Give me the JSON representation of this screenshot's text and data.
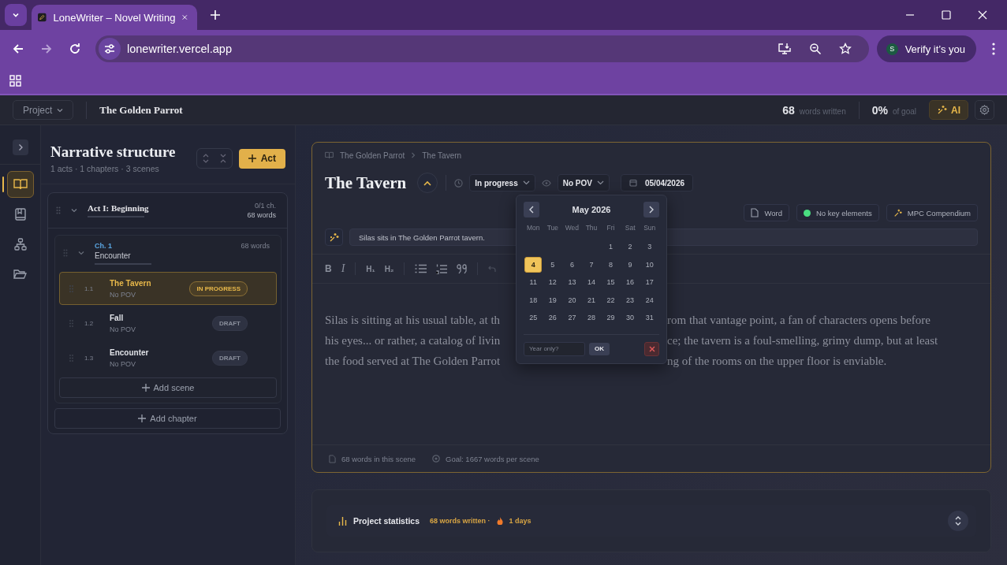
{
  "browser": {
    "tab_title": "LoneWriter – Novel Writing",
    "url": "lonewriter.vercel.app",
    "profile_initial": "S",
    "profile_label": "Verify it’s you"
  },
  "header": {
    "project_menu": "Project",
    "project_title": "The Golden Parrot",
    "words_count": "68",
    "words_label": "words written",
    "goal_percent": "0%",
    "goal_label": "of goal",
    "ai_button": "AI"
  },
  "rail": {
    "items": [
      {
        "kind": "book",
        "selected": true
      },
      {
        "kind": "bookmark",
        "selected": false
      },
      {
        "kind": "hierarchy",
        "selected": false
      },
      {
        "kind": "folder",
        "selected": false
      }
    ]
  },
  "structure": {
    "title": "Narrative structure",
    "summary": "1 acts · 1 chapters · 3 scenes",
    "add_act": "Act",
    "acts": [
      {
        "title": "Act I: Beginning",
        "expanded": true,
        "progress": "0/1 ch.",
        "words": "68 words",
        "add_chapter": "Add chapter",
        "chapters": [
          {
            "number": "Ch. 1",
            "title": "Encounter",
            "words": "68 words",
            "expanded": true,
            "add_scene": "Add scene",
            "scenes": [
              {
                "number": "1.1",
                "title": "The Tavern",
                "pov": "No POV",
                "status": "IN PROGRESS",
                "in_progress": true,
                "selected": true
              },
              {
                "number": "1.2",
                "title": "Fall",
                "pov": "No POV",
                "status": "DRAFT",
                "in_progress": false,
                "selected": false
              },
              {
                "number": "1.3",
                "title": "Encounter",
                "pov": "No POV",
                "status": "DRAFT",
                "in_progress": false,
                "selected": false
              }
            ]
          }
        ]
      }
    ]
  },
  "editor": {
    "breadcrumb": [
      "The Golden Parrot",
      "The Tavern"
    ],
    "title": "The Tavern",
    "status": "In progress",
    "pov": "No POV",
    "date": "05/04/2026",
    "chips": [
      {
        "kind": "file",
        "label": "Word"
      },
      {
        "kind": "dot",
        "label": "No key elements",
        "color": "#4ade80"
      },
      {
        "kind": "sparkle",
        "label": "MPC Compendium"
      }
    ],
    "summary": "Silas sits in The Golden Parrot tavern.",
    "toolbar_groups": [
      [
        {
          "kind": "bold",
          "label": "B"
        },
        {
          "kind": "italic",
          "label": "I"
        }
      ],
      [
        {
          "kind": "heading",
          "label": "H₁"
        },
        {
          "kind": "heading",
          "label": "H₂"
        }
      ],
      [
        {
          "kind": "bullets"
        },
        {
          "kind": "numbers"
        },
        {
          "kind": "quote"
        }
      ],
      [
        {
          "kind": "undo"
        }
      ]
    ],
    "lines": [
      {
        "left": "Silas is sitting at his usual table, at th",
        "right": "rom that vantage point, a fan of characters opens before"
      },
      {
        "left": "his eyes... or rather, a catalog of livin",
        "right": "ce; the tavern is a foul-smelling, grimy dump, but at least"
      },
      {
        "left": "the food served at The Golden Parrot",
        "right": "ng of the rooms on the upper floor is enviable."
      }
    ],
    "footer": {
      "words": "68 words in this scene",
      "goal": "Goal: 1667 words per scene"
    }
  },
  "calendar": {
    "month": "May 2026",
    "weekdays": [
      "Mon",
      "Tue",
      "Wed",
      "Thu",
      "Fri",
      "Sat",
      "Sun"
    ],
    "weeks": [
      {
        "starts_midweek": true,
        "days": [
          {
            "label": "1",
            "selected": false
          },
          {
            "label": "2",
            "selected": false
          },
          {
            "label": "3",
            "selected": false
          }
        ]
      },
      {
        "days": [
          {
            "label": "4",
            "selected": true
          },
          {
            "label": "5",
            "selected": false
          },
          {
            "label": "6",
            "selected": false
          },
          {
            "label": "7",
            "selected": false
          },
          {
            "label": "8",
            "selected": false
          },
          {
            "label": "9",
            "selected": false
          },
          {
            "label": "10",
            "selected": false
          }
        ]
      },
      {
        "days": [
          {
            "label": "11",
            "selected": false
          },
          {
            "label": "12",
            "selected": false
          },
          {
            "label": "13",
            "selected": false
          },
          {
            "label": "14",
            "selected": false
          },
          {
            "label": "15",
            "selected": false
          },
          {
            "label": "16",
            "selected": false
          },
          {
            "label": "17",
            "selected": false
          }
        ]
      },
      {
        "days": [
          {
            "label": "18",
            "selected": false
          },
          {
            "label": "19",
            "selected": false
          },
          {
            "label": "20",
            "selected": false
          },
          {
            "label": "21",
            "selected": false
          },
          {
            "label": "22",
            "selected": false
          },
          {
            "label": "23",
            "selected": false
          },
          {
            "label": "24",
            "selected": false
          }
        ]
      },
      {
        "days": [
          {
            "label": "25",
            "selected": false
          },
          {
            "label": "26",
            "selected": false
          },
          {
            "label": "27",
            "selected": false
          },
          {
            "label": "28",
            "selected": false
          },
          {
            "label": "29",
            "selected": false
          },
          {
            "label": "30",
            "selected": false
          },
          {
            "label": "31",
            "selected": false
          }
        ]
      }
    ],
    "year_placeholder": "Year only?",
    "ok_button": "OK"
  },
  "stats": {
    "title": "Project statistics",
    "words": "68 words written ·",
    "streak": "1 days"
  }
}
